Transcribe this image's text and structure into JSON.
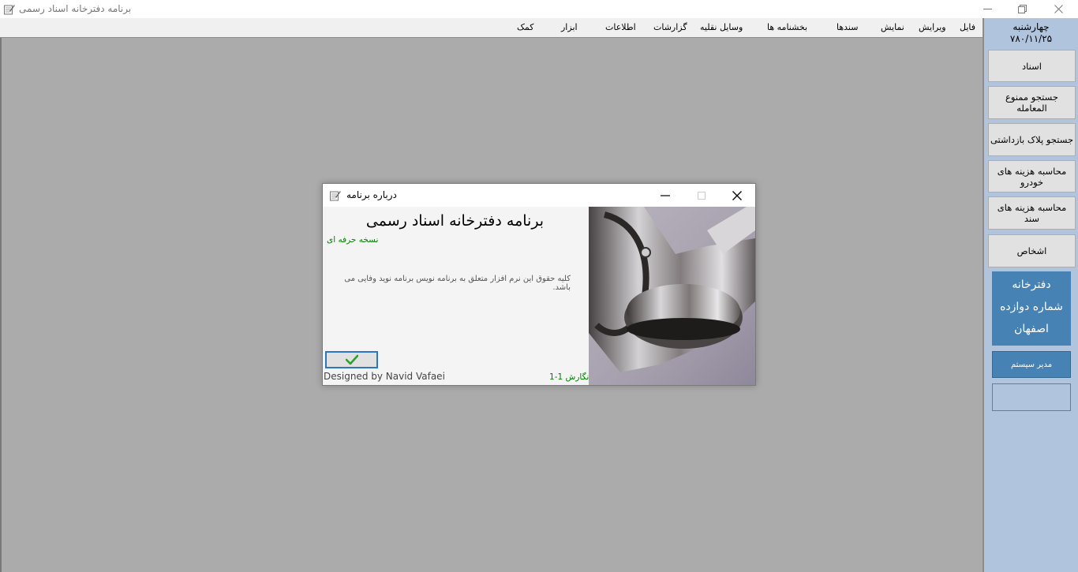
{
  "window": {
    "title": "برنامه دفترخانه اسناد رسمی",
    "icon": "notepad-pen-icon"
  },
  "menu": {
    "items": [
      {
        "label": "فایل"
      },
      {
        "label": "ویرایش"
      },
      {
        "label": "نمایش"
      },
      {
        "label": "سندها"
      },
      {
        "label": "بخشنامه ها"
      },
      {
        "label": "وسایل نقلیه"
      },
      {
        "label": "گزارشات"
      },
      {
        "label": "اطلاعات"
      },
      {
        "label": "ابزار"
      },
      {
        "label": "کمک"
      }
    ]
  },
  "sidebar": {
    "day": "چهارشنبه",
    "date": "۷۸۰/۱۱/۲۵",
    "buttons": [
      {
        "label": "اسناد"
      },
      {
        "label": "جستجو ممنوع المعامله"
      },
      {
        "label": "جستجو پلاک بازداشتی"
      },
      {
        "label": "محاسبه هزینه های خودرو"
      },
      {
        "label": "محاسبه هزینه های سند"
      },
      {
        "label": "اشخاص"
      }
    ],
    "office": {
      "line1": "دفترخانه",
      "line2": "شماره دوازده",
      "line3": "اصفهان"
    },
    "admin_label": "مدیر سیستم"
  },
  "about_dialog": {
    "title": "درباره برنامه",
    "product_name": "برنامه دفترخانه اسناد رسمی",
    "edition": "نسخه حرفه ای",
    "copyright": "کلیه حقوق این نرم افزار متعلق به برنامه نویس برنامه نوید وفایی  می باشد.",
    "designer": "Designed by Navid Vafaei",
    "version": "نگارش 1-1",
    "ok_icon": "checkmark-icon"
  },
  "colors": {
    "workspace": "#ababab",
    "sidebar": "#b0c4de",
    "accent": "#4682b4",
    "edition_text": "#008000"
  }
}
